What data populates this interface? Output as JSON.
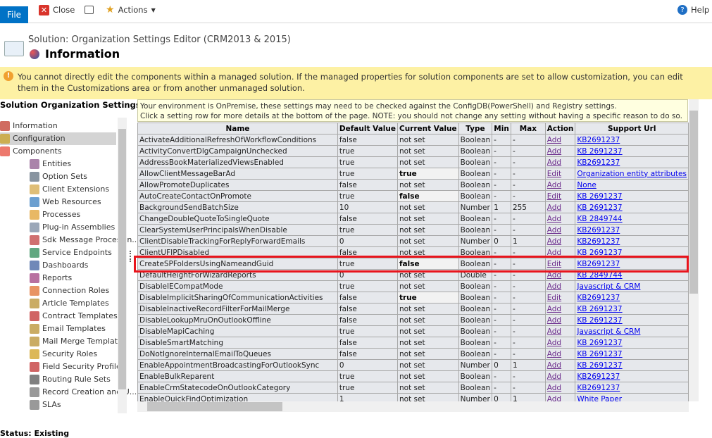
{
  "toolbar": {
    "file": "File",
    "close": "Close",
    "actions": "Actions",
    "help": "Help"
  },
  "header": {
    "subtitle": "Solution: Organization Settings Editor (CRM2013 & 2015)",
    "title": "Information"
  },
  "warning": "You cannot directly edit the components within a managed solution. If the managed properties for solution components are set to allow customization, you can edit them in the Customizations area or from another unmanaged solution.",
  "nav": {
    "title": "Solution Organization Settings Ed...",
    "items": [
      {
        "label": "Information",
        "icon": "information-icon",
        "color": "#c0392b",
        "level": 0
      },
      {
        "label": "Configuration",
        "icon": "configuration-icon",
        "color": "#c9a227",
        "level": 0,
        "selected": true
      },
      {
        "label": "Components",
        "icon": "components-icon",
        "color": "#e74c3c",
        "level": 0
      },
      {
        "label": "Entities",
        "icon": "entities-icon",
        "color": "#8e5a8e",
        "level": 1
      },
      {
        "label": "Option Sets",
        "icon": "option-sets-icon",
        "color": "#607080",
        "level": 1
      },
      {
        "label": "Client Extensions",
        "icon": "client-extensions-icon",
        "color": "#d4a84a",
        "level": 1
      },
      {
        "label": "Web Resources",
        "icon": "web-resources-icon",
        "color": "#3a7fc0",
        "level": 1
      },
      {
        "label": "Processes",
        "icon": "processes-icon",
        "color": "#e0a030",
        "level": 1
      },
      {
        "label": "Plug-in Assemblies",
        "icon": "plugin-assemblies-icon",
        "color": "#7a8aa0",
        "level": 1
      },
      {
        "label": "Sdk Message Processin...",
        "icon": "sdk-message-icon",
        "color": "#c04040",
        "level": 1
      },
      {
        "label": "Service Endpoints",
        "icon": "service-endpoints-icon",
        "color": "#2e8b57",
        "level": 1
      },
      {
        "label": "Dashboards",
        "icon": "dashboards-icon",
        "color": "#4060a0",
        "level": 1
      },
      {
        "label": "Reports",
        "icon": "reports-icon",
        "color": "#a04080",
        "level": 1
      },
      {
        "label": "Connection Roles",
        "icon": "connection-roles-icon",
        "color": "#e07030",
        "level": 1
      },
      {
        "label": "Article Templates",
        "icon": "article-templates-icon",
        "color": "#b89030",
        "level": 1
      },
      {
        "label": "Contract Templates",
        "icon": "contract-templates-icon",
        "color": "#c03030",
        "level": 1
      },
      {
        "label": "Email Templates",
        "icon": "email-templates-icon",
        "color": "#b89030",
        "level": 1
      },
      {
        "label": "Mail Merge Templates",
        "icon": "mail-merge-templates-icon",
        "color": "#b89030",
        "level": 1
      },
      {
        "label": "Security Roles",
        "icon": "security-roles-icon",
        "color": "#d0a020",
        "level": 1
      },
      {
        "label": "Field Security Profiles",
        "icon": "field-security-icon",
        "color": "#c03030",
        "level": 1
      },
      {
        "label": "Routing Rule Sets",
        "icon": "routing-rule-icon",
        "color": "#555555",
        "level": 1
      },
      {
        "label": "Record Creation and U...",
        "icon": "record-creation-icon",
        "color": "#777777",
        "level": 1
      },
      {
        "label": "SLAs",
        "icon": "sla-icon",
        "color": "#777777",
        "level": 1
      }
    ]
  },
  "note": {
    "line1": "Your environment is OnPremise, these settings may need to be checked against the ConfigDB(PowerShell) and Registry settings.",
    "line2": "Click a setting row for more details at the bottom of the page. NOTE: you should not change any setting without having a specific reason to do so."
  },
  "table": {
    "columns": [
      "Name",
      "Default Value",
      "Current Value",
      "Type",
      "Min",
      "Max",
      "Action",
      "Support Url"
    ],
    "rows": [
      [
        "ActivateAdditionalRefreshOfWorkflowConditions",
        "false",
        "not set",
        "Boolean",
        "-",
        "-",
        "Add",
        "KB2691237"
      ],
      [
        "ActivityConvertDlgCampaignUnchecked",
        "true",
        "not set",
        "Boolean",
        "-",
        "-",
        "Add",
        "KB 2691237"
      ],
      [
        "AddressBookMaterializedViewsEnabled",
        "true",
        "not set",
        "Boolean",
        "-",
        "-",
        "Add",
        "KB2691237"
      ],
      [
        "AllowClientMessageBarAd",
        "true",
        "true",
        "Boolean",
        "-",
        "-",
        "Edit",
        "Organization entity attributes"
      ],
      [
        "AllowPromoteDuplicates",
        "false",
        "not set",
        "Boolean",
        "-",
        "-",
        "Add",
        "None"
      ],
      [
        "AutoCreateContactOnPromote",
        "true",
        "false",
        "Boolean",
        "-",
        "-",
        "Edit",
        "KB 2691237"
      ],
      [
        "BackgroundSendBatchSize",
        "10",
        "not set",
        "Number",
        "1",
        "255",
        "Add",
        "KB 2691237"
      ],
      [
        "ChangeDoubleQuoteToSingleQuote",
        "false",
        "not set",
        "Boolean",
        "-",
        "-",
        "Add",
        "KB 2849744"
      ],
      [
        "ClearSystemUserPrincipalsWhenDisable",
        "true",
        "not set",
        "Boolean",
        "-",
        "-",
        "Add",
        "KB2691237"
      ],
      [
        "ClientDisableTrackingForReplyForwardEmails",
        "0",
        "not set",
        "Number",
        "0",
        "1",
        "Add",
        "KB2691237"
      ],
      [
        "ClientUFIPDisabled",
        "false",
        "not set",
        "Boolean",
        "-",
        "-",
        "Add",
        "KB 2691237"
      ],
      [
        "CreateSPFoldersUsingNameandGuid",
        "true",
        "false",
        "Boolean",
        "-",
        "-",
        "Edit",
        "KB2691237"
      ],
      [
        "DefaultHeightForWizardReports",
        "0",
        "not set",
        "Double",
        "-",
        "-",
        "Add",
        "KB 2849744"
      ],
      [
        "DisableIECompatMode",
        "true",
        "not set",
        "Boolean",
        "-",
        "-",
        "Add",
        "Javascript & CRM"
      ],
      [
        "DisableImplicitSharingOfCommunicationActivities",
        "false",
        "true",
        "Boolean",
        "-",
        "-",
        "Edit",
        "KB2691237"
      ],
      [
        "DisableInactiveRecordFilterForMailMerge",
        "false",
        "not set",
        "Boolean",
        "-",
        "-",
        "Add",
        "KB 2691237"
      ],
      [
        "DisableLookupMruOnOutlookOffline",
        "false",
        "not set",
        "Boolean",
        "-",
        "-",
        "Add",
        "KB 2691237"
      ],
      [
        "DisableMapiCaching",
        "true",
        "not set",
        "Boolean",
        "-",
        "-",
        "Add",
        "Javascript & CRM"
      ],
      [
        "DisableSmartMatching",
        "false",
        "not set",
        "Boolean",
        "-",
        "-",
        "Add",
        "KB 2691237"
      ],
      [
        "DoNotIgnoreInternalEmailToQueues",
        "false",
        "not set",
        "Boolean",
        "-",
        "-",
        "Add",
        "KB 2691237"
      ],
      [
        "EnableAppointmentBroadcastingForOutlookSync",
        "0",
        "not set",
        "Number",
        "0",
        "1",
        "Add",
        "KB 2691237"
      ],
      [
        "EnableBulkReparent",
        "true",
        "not set",
        "Boolean",
        "-",
        "-",
        "Add",
        "KB2691237"
      ],
      [
        "EnableCrmStatecodeOnOutlookCategory",
        "true",
        "not set",
        "Boolean",
        "-",
        "-",
        "Add",
        "KB2691237"
      ],
      [
        "EnableQuickFindOptimization",
        "1",
        "not set",
        "Number",
        "0",
        "1",
        "Add",
        "White Paper"
      ]
    ],
    "highlighted_row": 11
  },
  "status": "Status: Existing"
}
